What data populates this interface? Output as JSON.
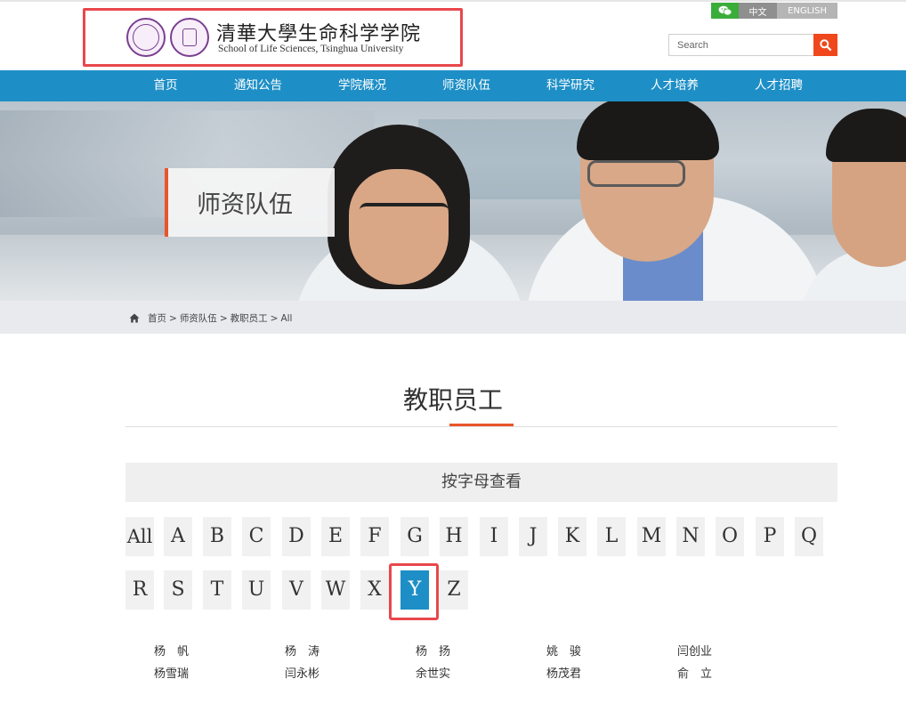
{
  "header": {
    "logo_cn": "清華大學生命科学学院",
    "logo_en": "School of Life Sciences, Tsinghua University",
    "lang_cn": "中文",
    "lang_en": "ENGLISH",
    "search_placeholder": "Search"
  },
  "nav": [
    {
      "label": "首页"
    },
    {
      "label": "通知公告"
    },
    {
      "label": "学院概况"
    },
    {
      "label": "师资队伍"
    },
    {
      "label": "科学研究"
    },
    {
      "label": "人才培养"
    },
    {
      "label": "人才招聘"
    }
  ],
  "banner": {
    "title": "师资队伍"
  },
  "breadcrumb": {
    "items": [
      "首页",
      "师资队伍",
      "教职员工",
      "All"
    ],
    "separator": ">"
  },
  "section": {
    "title": "教职员工",
    "alpha_heading": "按字母查看"
  },
  "letters": [
    "All",
    "A",
    "B",
    "C",
    "D",
    "E",
    "F",
    "G",
    "H",
    "I",
    "J",
    "K",
    "L",
    "M",
    "N",
    "O",
    "P",
    "Q",
    "R",
    "S",
    "T",
    "U",
    "V",
    "W",
    "X",
    "Y",
    "Z"
  ],
  "selected_letter": "Y",
  "people": [
    "杨　帆",
    "杨　涛",
    "杨　扬",
    "姚　骏",
    "闫创业",
    "杨雪瑞",
    "闫永彬",
    "余世实",
    "杨茂君",
    "俞　立"
  ],
  "colors": {
    "nav": "#1e8fc6",
    "accent": "#e8552b",
    "search_button": "#f0481c",
    "selected_letter": "#1e8fc6",
    "highlight_box": "#e8474c",
    "wechat": "#3aac3a"
  }
}
